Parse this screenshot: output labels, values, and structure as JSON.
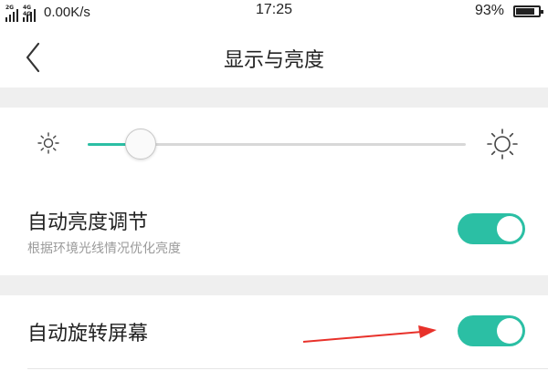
{
  "status_bar": {
    "signal1_tag": "2G",
    "signal2_tag": "4G 4G",
    "net_speed": "0.00K/s",
    "time": "17:25",
    "battery_percent": "93%",
    "battery_level": 0.93
  },
  "header": {
    "title": "显示与亮度"
  },
  "brightness": {
    "level": 0.14,
    "accent_color": "#2bbfa4"
  },
  "settings": {
    "auto_brightness": {
      "title": "自动亮度调节",
      "subtitle": "根据环境光线情况优化亮度",
      "enabled": true
    },
    "auto_rotate": {
      "title": "自动旋转屏幕",
      "enabled": true
    }
  },
  "icons": [
    "back-chevron-icon",
    "brightness-low-icon",
    "brightness-high-icon",
    "annotation-arrow-icon"
  ],
  "colors": {
    "accent": "#2bbfa4",
    "annotation_arrow": "#e8312a",
    "section_divider": "#efefef"
  }
}
